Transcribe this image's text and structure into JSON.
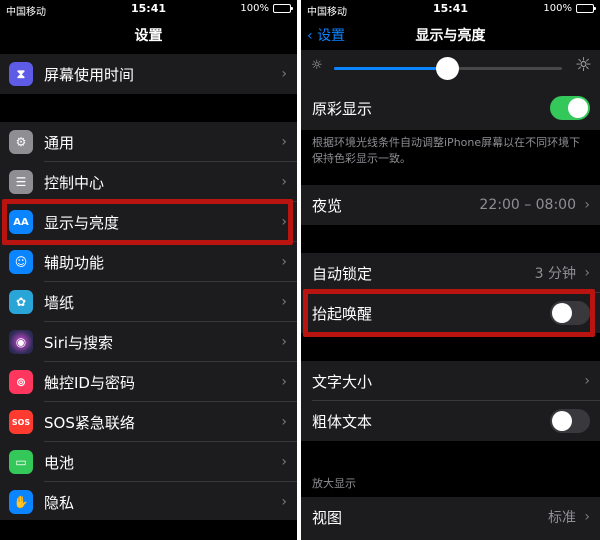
{
  "left": {
    "status": {
      "carrier": "中国移动",
      "time": "15:41",
      "battery": "100%"
    },
    "nav_title": "设置",
    "items": [
      {
        "label": "屏幕使用时间",
        "icon": "hourglass-icon",
        "color": "#5e5ce6"
      },
      {
        "label": "通用",
        "icon": "gear-icon",
        "color": "#8e8e93"
      },
      {
        "label": "控制中心",
        "icon": "switches-icon",
        "color": "#8e8e93"
      },
      {
        "label": "显示与亮度",
        "icon": "text-size-icon",
        "color": "#0a84ff",
        "icon_text": "AA"
      },
      {
        "label": "辅助功能",
        "icon": "accessibility-icon",
        "color": "#0a84ff"
      },
      {
        "label": "墙纸",
        "icon": "flower-icon",
        "color": "#2aa5d8"
      },
      {
        "label": "Siri与搜索",
        "icon": "siri-icon",
        "color": "#2b2b55"
      },
      {
        "label": "触控ID与密码",
        "icon": "fingerprint-icon",
        "color": "#ff375f"
      },
      {
        "label": "SOS紧急联络",
        "icon": "sos-icon",
        "color": "#ff3b30",
        "icon_text": "SOS"
      },
      {
        "label": "电池",
        "icon": "battery-icon",
        "color": "#34c759"
      },
      {
        "label": "隐私",
        "icon": "hand-icon",
        "color": "#0a84ff"
      }
    ]
  },
  "right": {
    "status": {
      "carrier": "中国移动",
      "time": "15:41",
      "battery": "100%"
    },
    "nav_back": "设置",
    "nav_title": "显示与亮度",
    "brightness": 0.5,
    "true_tone": {
      "label": "原彩显示",
      "on": true
    },
    "true_tone_desc": "根据环境光线条件自动调整iPhone屏幕以在不同环境下保持色彩显示一致。",
    "night_shift": {
      "label": "夜览",
      "value": "22:00 – 08:00"
    },
    "auto_lock": {
      "label": "自动锁定",
      "value": "3 分钟"
    },
    "raise_to_wake": {
      "label": "抬起唤醒",
      "on": false
    },
    "text_size": {
      "label": "文字大小"
    },
    "bold_text": {
      "label": "粗体文本",
      "on": false
    },
    "zoom_header": "放大显示",
    "view": {
      "label": "视图",
      "value": "标准"
    }
  },
  "colors": {
    "highlight": "#b9140f",
    "accent": "#0a84ff",
    "toggle_on": "#34c759"
  }
}
